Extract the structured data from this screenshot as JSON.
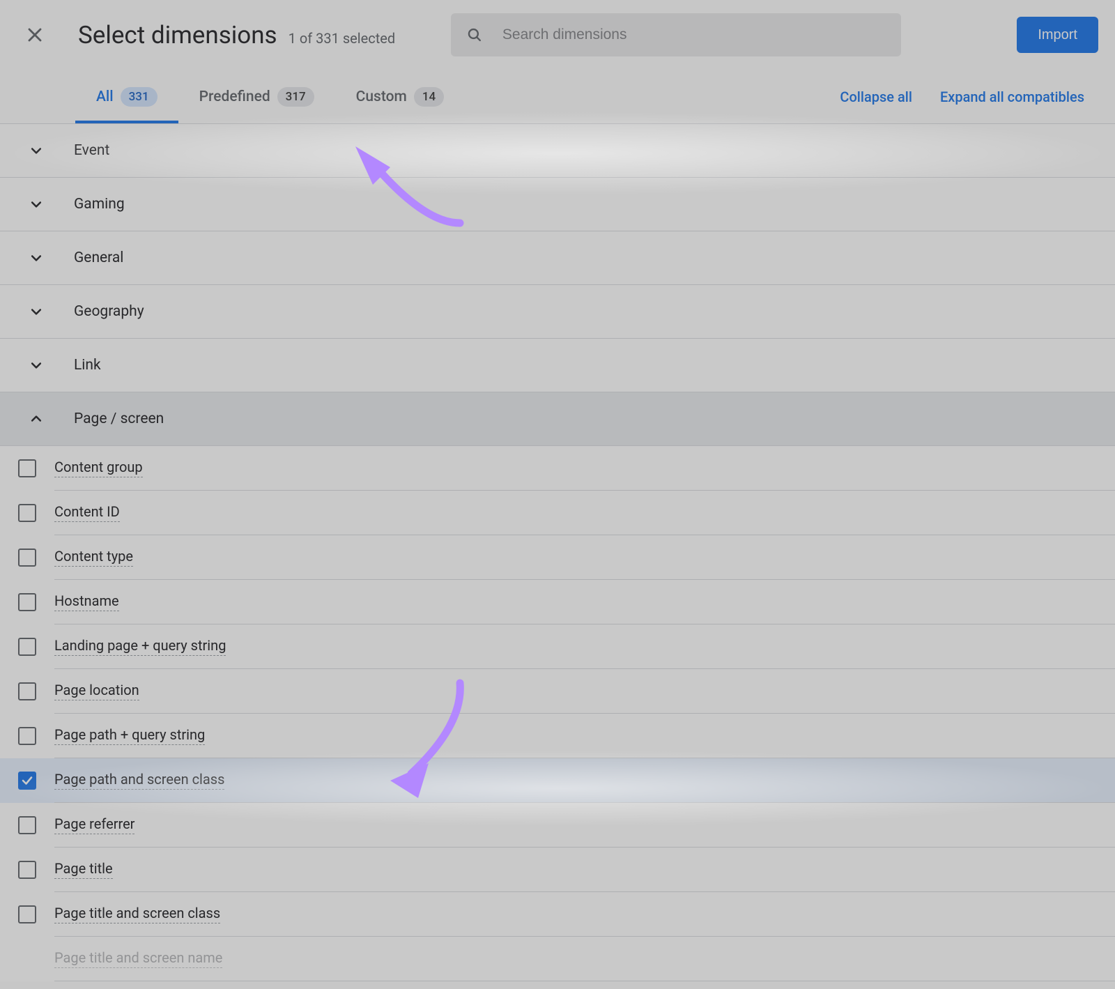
{
  "header": {
    "title": "Select dimensions",
    "subtitle": "1 of 331 selected",
    "search_placeholder": "Search dimensions",
    "import_label": "Import"
  },
  "tabs": [
    {
      "label": "All",
      "count": "331",
      "active": true
    },
    {
      "label": "Predefined",
      "count": "317",
      "active": false
    },
    {
      "label": "Custom",
      "count": "14",
      "active": false
    }
  ],
  "actions": {
    "collapse_label": "Collapse all",
    "expand_label": "Expand all compatibles"
  },
  "categories": [
    {
      "label": "Event",
      "expanded": false
    },
    {
      "label": "Gaming",
      "expanded": false
    },
    {
      "label": "General",
      "expanded": false
    },
    {
      "label": "Geography",
      "expanded": false
    },
    {
      "label": "Link",
      "expanded": false
    },
    {
      "label": "Page / screen",
      "expanded": true
    }
  ],
  "page_screen_items": [
    {
      "label": "Content group",
      "checked": false
    },
    {
      "label": "Content ID",
      "checked": false
    },
    {
      "label": "Content type",
      "checked": false
    },
    {
      "label": "Hostname",
      "checked": false
    },
    {
      "label": "Landing page + query string",
      "checked": false
    },
    {
      "label": "Page location",
      "checked": false
    },
    {
      "label": "Page path + query string",
      "checked": false
    },
    {
      "label": "Page path and screen class",
      "checked": true
    },
    {
      "label": "Page referrer",
      "checked": false
    },
    {
      "label": "Page title",
      "checked": false
    },
    {
      "label": "Page title and screen class",
      "checked": false
    },
    {
      "label": "Page title and screen name",
      "checked": false,
      "faded": true
    }
  ],
  "colors": {
    "accent": "#1a73e8",
    "annotation_arrow": "#b388ff"
  }
}
